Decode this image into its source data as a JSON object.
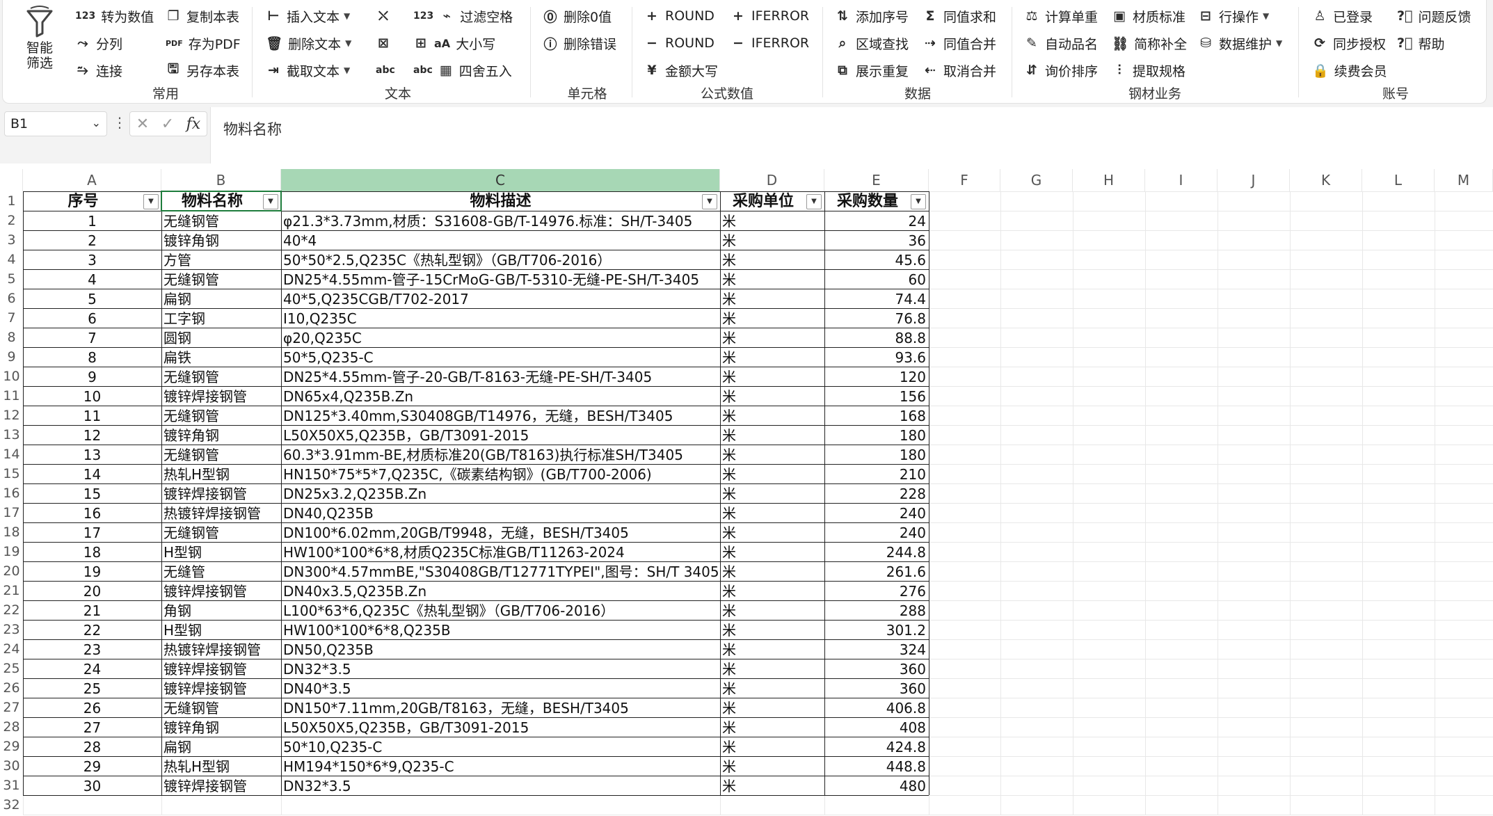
{
  "ribbon": {
    "smart_filter": "智能\n筛选",
    "common": {
      "label": "常用",
      "items": [
        {
          "icon": "123",
          "label": "转为数值"
        },
        {
          "icon": "split",
          "label": "分列"
        },
        {
          "icon": "link",
          "label": "连接"
        },
        {
          "icon": "copy",
          "label": "复制本表"
        },
        {
          "icon": "pdf",
          "label": "存为PDF"
        },
        {
          "icon": "save-as",
          "label": "另存本表"
        }
      ]
    },
    "text": {
      "label": "文本",
      "items": [
        {
          "icon": "insert",
          "label": "插入文本"
        },
        {
          "icon": "delete",
          "label": "删除文本"
        },
        {
          "icon": "extract",
          "label": "截取文本"
        },
        {
          "icon": "123",
          "label": "过滤空格"
        },
        {
          "icon": "aA",
          "label": "大小写"
        },
        {
          "icon": "abc",
          "label": "四舍五入"
        }
      ]
    },
    "cell": {
      "label": "单元格",
      "items": [
        {
          "icon": "zero",
          "label": "删除0值"
        },
        {
          "icon": "error",
          "label": "删除错误"
        }
      ]
    },
    "formula": {
      "label": "公式数值",
      "items": [
        {
          "icon": "+",
          "label": "ROUND"
        },
        {
          "icon": "−",
          "label": "ROUND"
        },
        {
          "icon": "¥",
          "label": "金额大写"
        },
        {
          "icon": "+",
          "label": "IFERROR"
        },
        {
          "icon": "−",
          "label": "IFERROR"
        }
      ]
    },
    "data": {
      "label": "数据",
      "items": [
        {
          "icon": "seq",
          "label": "添加序号"
        },
        {
          "icon": "find",
          "label": "区域查找"
        },
        {
          "icon": "dup",
          "label": "展示重复"
        },
        {
          "icon": "sum",
          "label": "同值求和"
        },
        {
          "icon": "merge",
          "label": "同值合并"
        },
        {
          "icon": "unmerge",
          "label": "取消合并"
        }
      ]
    },
    "steel": {
      "label": "钢材业务",
      "items": [
        {
          "icon": "weight",
          "label": "计算单重"
        },
        {
          "icon": "auto-name",
          "label": "自动品名"
        },
        {
          "icon": "sort",
          "label": "询价排序"
        },
        {
          "icon": "material",
          "label": "材质标准"
        },
        {
          "icon": "abbr",
          "label": "简称补全"
        },
        {
          "icon": "spec",
          "label": "提取规格"
        },
        {
          "icon": "row-op",
          "label": "行操作"
        },
        {
          "icon": "db",
          "label": "数据维护"
        }
      ]
    },
    "account": {
      "label": "账号",
      "items": [
        {
          "icon": "user",
          "label": "已登录"
        },
        {
          "icon": "sync",
          "label": "同步授权"
        },
        {
          "icon": "lock",
          "label": "续费会员"
        },
        {
          "icon": "question",
          "label": "问题反馈"
        },
        {
          "icon": "question",
          "label": "帮助"
        }
      ]
    }
  },
  "formula_bar": {
    "cell_ref": "B1",
    "value": "物料名称"
  },
  "columns": [
    "A",
    "B",
    "C",
    "D",
    "E",
    "F",
    "G",
    "H",
    "I",
    "J",
    "K",
    "L",
    "M"
  ],
  "selected_column": "C",
  "rows_shown": 32,
  "table": {
    "headers": [
      "序号",
      "物料名称",
      "物料描述",
      "采购单位",
      "采购数量"
    ],
    "rows": [
      [
        "1",
        "无缝钢管",
        "φ21.3*3.73mm,材质：S31608-GB/T-14976.标准：SH/T-3405",
        "米",
        "24"
      ],
      [
        "2",
        "镀锌角钢",
        "40*4",
        "米",
        "36"
      ],
      [
        "3",
        "方管",
        "50*50*2.5,Q235C《热轧型钢》（GB/T706-2016）",
        "米",
        "45.6"
      ],
      [
        "4",
        "无缝钢管",
        "DN25*4.55mm-管子-15CrMoG-GB/T-5310-无缝-PE-SH/T-3405",
        "米",
        "60"
      ],
      [
        "5",
        "扁钢",
        "40*5,Q235CGB/T702-2017",
        "米",
        "74.4"
      ],
      [
        "6",
        "工字钢",
        "I10,Q235C",
        "米",
        "76.8"
      ],
      [
        "7",
        "圆钢",
        "φ20,Q235C",
        "米",
        "88.8"
      ],
      [
        "8",
        "扁铁",
        "50*5,Q235-C",
        "米",
        "93.6"
      ],
      [
        "9",
        "无缝钢管",
        "DN25*4.55mm-管子-20-GB/T-8163-无缝-PE-SH/T-3405",
        "米",
        "120"
      ],
      [
        "10",
        "镀锌焊接钢管",
        "DN65x4,Q235B.Zn",
        "米",
        "156"
      ],
      [
        "11",
        "无缝钢管",
        "DN125*3.40mm,S30408GB/T14976，无缝，BESH/T3405",
        "米",
        "168"
      ],
      [
        "12",
        "镀锌角钢",
        "L50X50X5,Q235B，GB/T3091-2015",
        "米",
        "180"
      ],
      [
        "13",
        "无缝钢管",
        "60.3*3.91mm-BE,材质标准20(GB/T8163)执行标准SH/T3405",
        "米",
        "180"
      ],
      [
        "14",
        "热轧H型钢",
        "HN150*75*5*7,Q235C,《碳素结构钢》(GB/T700-2006)",
        "米",
        "210"
      ],
      [
        "15",
        "镀锌焊接钢管",
        "DN25x3.2,Q235B.Zn",
        "米",
        "228"
      ],
      [
        "16",
        "热镀锌焊接钢管",
        "DN40,Q235B",
        "米",
        "240"
      ],
      [
        "17",
        "无缝钢管",
        "DN100*6.02mm,20GB/T9948，无缝，BESH/T3405",
        "米",
        "240"
      ],
      [
        "18",
        "H型钢",
        "HW100*100*6*8,材质Q235C标准GB/T11263-2024",
        "米",
        "244.8"
      ],
      [
        "19",
        "无缝管",
        "DN300*4.57mmBE,\"S30408GB/T12771TYPEI\",图号：SH/T 3405",
        "米",
        "261.6"
      ],
      [
        "20",
        "镀锌焊接钢管",
        "DN40x3.5,Q235B.Zn",
        "米",
        "276"
      ],
      [
        "21",
        "角钢",
        "L100*63*6,Q235C《热轧型钢》（GB/T706-2016）",
        "米",
        "288"
      ],
      [
        "22",
        "H型钢",
        "HW100*100*6*8,Q235B",
        "米",
        "301.2"
      ],
      [
        "23",
        "热镀锌焊接钢管",
        "DN50,Q235B",
        "米",
        "324"
      ],
      [
        "24",
        "镀锌焊接钢管",
        "DN32*3.5",
        "米",
        "360"
      ],
      [
        "25",
        "镀锌焊接钢管",
        "DN40*3.5",
        "米",
        "360"
      ],
      [
        "26",
        "无缝钢管",
        "DN150*7.11mm,20GB/T8163，无缝，BESH/T3405",
        "米",
        "406.8"
      ],
      [
        "27",
        "镀锌角钢",
        "L50X50X5,Q235B，GB/T3091-2015",
        "米",
        "408"
      ],
      [
        "28",
        "扁钢",
        "50*10,Q235-C",
        "米",
        "424.8"
      ],
      [
        "29",
        "热轧H型钢",
        "HM194*150*6*9,Q235-C",
        "米",
        "448.8"
      ],
      [
        "30",
        "镀锌焊接钢管",
        "DN32*3.5",
        "米",
        "480"
      ]
    ]
  },
  "colors": {
    "selected_col_header": "#a7d7b5",
    "ribbon_bg": "#ffffff",
    "chrome_bg": "#f3f3f3"
  }
}
